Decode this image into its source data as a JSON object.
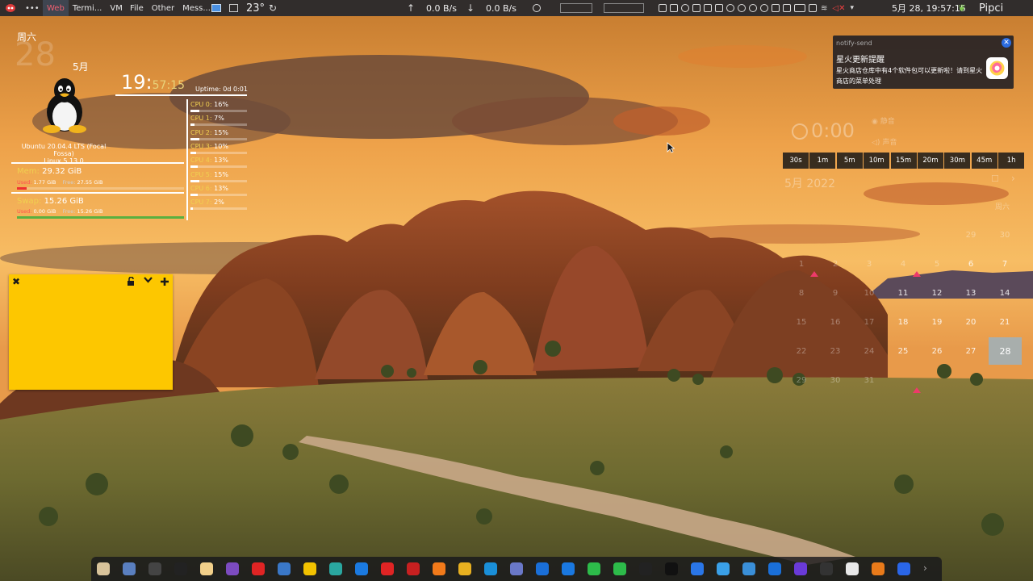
{
  "topbar": {
    "apps": [
      "Web",
      "Termi...",
      "VM",
      "File",
      "Other",
      "Mess..."
    ],
    "weather": "23°",
    "net_up": "0.0 B/s",
    "net_down": "0.0 B/s",
    "datetime": "5月 28, 19:57:15",
    "user": "Pipci"
  },
  "monitor": {
    "weekday": "周六",
    "day": "28",
    "month": "5月",
    "clock_hm": "19:",
    "clock_sec": "57:15",
    "uptime": "Uptime: 0d 0:01",
    "os": [
      "Ubuntu 20.04.4 LTS (Focal Fossa)",
      "Linux 5.13.0"
    ],
    "mem": {
      "label": "Mem:",
      "total": "29.32 GiB",
      "used_label": "Used:",
      "used": "1.77 GiB",
      "free_label": "Free:",
      "free": "27.55 GiB",
      "used_frac": 0.06
    },
    "swap": {
      "label": "Swap:",
      "total": "15.26 GiB",
      "used_label": "Used:",
      "used": "0.00 GiB",
      "free_label": "Free:",
      "free": "15.26 GiB",
      "used_frac": 0.0
    },
    "cpus": [
      {
        "label": "CPU 0:",
        "value": "16%",
        "frac": 0.16
      },
      {
        "label": "CPU 1:",
        "value": "7%",
        "frac": 0.07
      },
      {
        "label": "CPU 2:",
        "value": "15%",
        "frac": 0.15
      },
      {
        "label": "CPU 3:",
        "value": "10%",
        "frac": 0.1
      },
      {
        "label": "CPU 4:",
        "value": "13%",
        "frac": 0.13
      },
      {
        "label": "CPU 5:",
        "value": "15%",
        "frac": 0.15
      },
      {
        "label": "CPU 6:",
        "value": "13%",
        "frac": 0.13
      },
      {
        "label": "CPU 7:",
        "value": "2%",
        "frac": 0.02
      }
    ]
  },
  "sticky": {
    "close": "✖",
    "lock": "🔓",
    "menu": "❤",
    "add": "✚",
    "color": "#fdc700"
  },
  "notification": {
    "app": "notify-send",
    "title": "星火更新提醒",
    "body": "星火商店仓库中有4个软件包可以更新啦！请到星火商店的菜单处理",
    "close": "✕"
  },
  "timer": {
    "display": "0:00",
    "ghost_right": "静音",
    "ghost_sound": "声音",
    "buttons": [
      "30s",
      "1m",
      "5m",
      "10m",
      "15m",
      "20m",
      "30m",
      "45m",
      "1h"
    ]
  },
  "calendar": {
    "ghost_date": "5月  2022",
    "ghost_weekday": "周六",
    "rows": [
      [
        "",
        "",
        "",
        "",
        "",
        "29",
        "30"
      ],
      [
        "1",
        "2",
        "3",
        "4",
        "5",
        "6",
        "7"
      ],
      [
        "8",
        "9",
        "10",
        "11",
        "12",
        "13",
        "14"
      ],
      [
        "15",
        "16",
        "17",
        "18",
        "19",
        "20",
        "21"
      ],
      [
        "22",
        "23",
        "24",
        "25",
        "26",
        "27",
        "28"
      ],
      [
        "29",
        "30",
        "31",
        "",
        "",
        "",
        ""
      ]
    ],
    "today": "28",
    "accent": "#ee3a6a"
  },
  "dock": {
    "icons": [
      "files-icon",
      "virtualbox-icon",
      "terminal-icon",
      "search-icon",
      "gimp-icon",
      "tor-icon",
      "wps-icon",
      "remmina-icon",
      "text-icon",
      "spark-store-icon",
      "todo-icon",
      "microsoft-icon",
      "filezilla-icon",
      "firefox-icon",
      "chrome-icon",
      "deepin-mail-icon",
      "gnome-boxes-icon",
      "mail-icon",
      "qq-search-icon",
      "wechat-icon",
      "wechat-work-icon",
      "qq-icon",
      "typora-icon",
      "baidu-netdisk-icon",
      "spark-icon",
      "notes-icon",
      "deepin-draw-icon",
      "obsidian-icon",
      "installer-icon",
      "reader-icon",
      "blender-icon",
      "ticktick-icon",
      "expand-icon"
    ]
  }
}
